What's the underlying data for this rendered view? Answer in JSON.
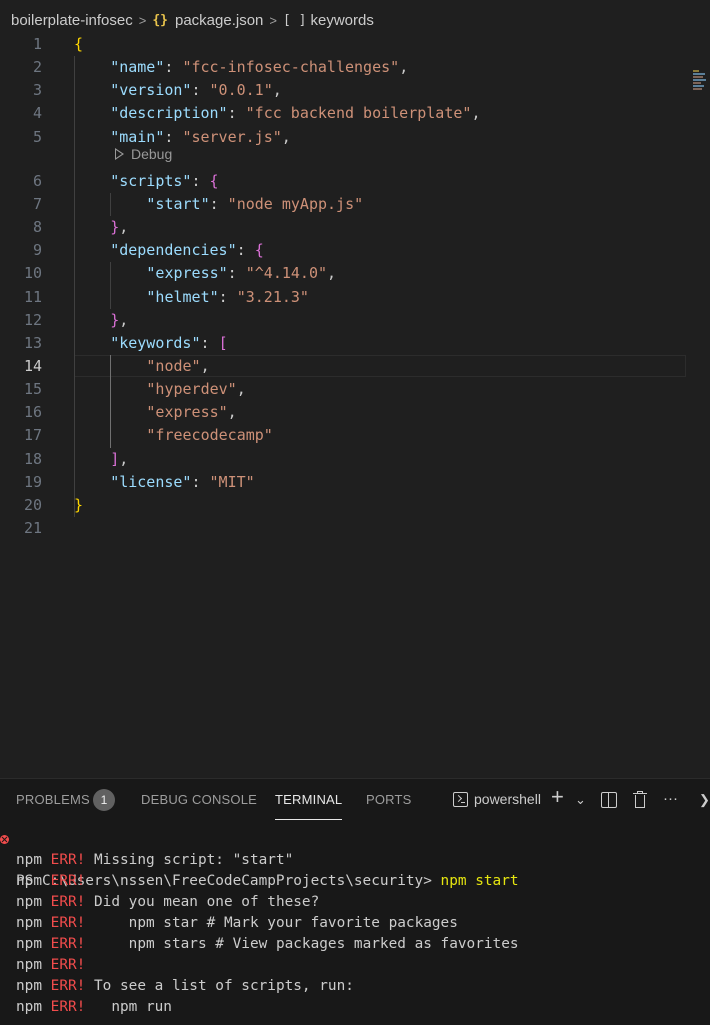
{
  "breadcrumb": {
    "folder": "boilerplate-infosec",
    "file_icon": "{}",
    "file": "package.json",
    "symbol_icon": "[ ]",
    "symbol": "keywords",
    "separator": ">"
  },
  "editor": {
    "active_line": 14,
    "codelens": "Debug",
    "lines": [
      {
        "n": "1",
        "t": "{"
      },
      {
        "n": "2",
        "k": "\"name\"",
        "v": "\"fcc-infosec-challenges\"",
        "e": ","
      },
      {
        "n": "3",
        "k": "\"version\"",
        "v": "\"0.0.1\"",
        "e": ","
      },
      {
        "n": "4",
        "k": "\"description\"",
        "v": "\"fcc backend boilerplate\"",
        "e": ","
      },
      {
        "n": "5",
        "k": "\"main\"",
        "v": "\"server.js\"",
        "e": ","
      },
      {
        "n": "6",
        "k": "\"scripts\"",
        "o": "{"
      },
      {
        "n": "7",
        "k": "\"start\"",
        "v": "\"node myApp.js\""
      },
      {
        "n": "8",
        "c": "}",
        "e": ","
      },
      {
        "n": "9",
        "k": "\"dependencies\"",
        "o": "{"
      },
      {
        "n": "10",
        "k": "\"express\"",
        "v": "\"^4.14.0\"",
        "e": ","
      },
      {
        "n": "11",
        "k": "\"helmet\"",
        "v": "\"3.21.3\""
      },
      {
        "n": "12",
        "c": "}",
        "e": ","
      },
      {
        "n": "13",
        "k": "\"keywords\"",
        "o": "["
      },
      {
        "n": "14",
        "v": "\"node\"",
        "e": ","
      },
      {
        "n": "15",
        "v": "\"hyperdev\"",
        "e": ","
      },
      {
        "n": "16",
        "v": "\"express\"",
        "e": ","
      },
      {
        "n": "17",
        "v": "\"freecodecamp\""
      },
      {
        "n": "18",
        "c": "]",
        "e": ","
      },
      {
        "n": "19",
        "k": "\"license\"",
        "v": "\"MIT\""
      },
      {
        "n": "20",
        "t": "}"
      },
      {
        "n": "21"
      }
    ]
  },
  "panel": {
    "tabs": {
      "problems": "PROBLEMS",
      "problems_count": "1",
      "debug_console": "DEBUG CONSOLE",
      "terminal": "TERMINAL",
      "ports": "PORTS"
    },
    "active_tab": "TERMINAL",
    "terminal_type": "powershell",
    "actions": {
      "new_terminal": "+",
      "launch_profile": "⌄",
      "more": "···",
      "more_tabs": "❯"
    }
  },
  "terminal": {
    "prompt": "PS C:\\Users\\nssen\\FreeCodeCampProjects\\security>",
    "command": "npm start",
    "prefix": "npm",
    "err": "ERR!",
    "lines": [
      "Missing script: \"start\"",
      "",
      "Did you mean one of these?",
      "    npm star # Mark your favorite packages",
      "    npm stars # View packages marked as favorites",
      "",
      "To see a list of scripts, run:",
      "  npm run"
    ]
  },
  "colors": {
    "background": "#1f1f1f",
    "key": "#9cdcfe",
    "string": "#ce9178",
    "bracket_level1": "#ffd700",
    "bracket_level2": "#da70d6",
    "error": "#f14c4c"
  }
}
